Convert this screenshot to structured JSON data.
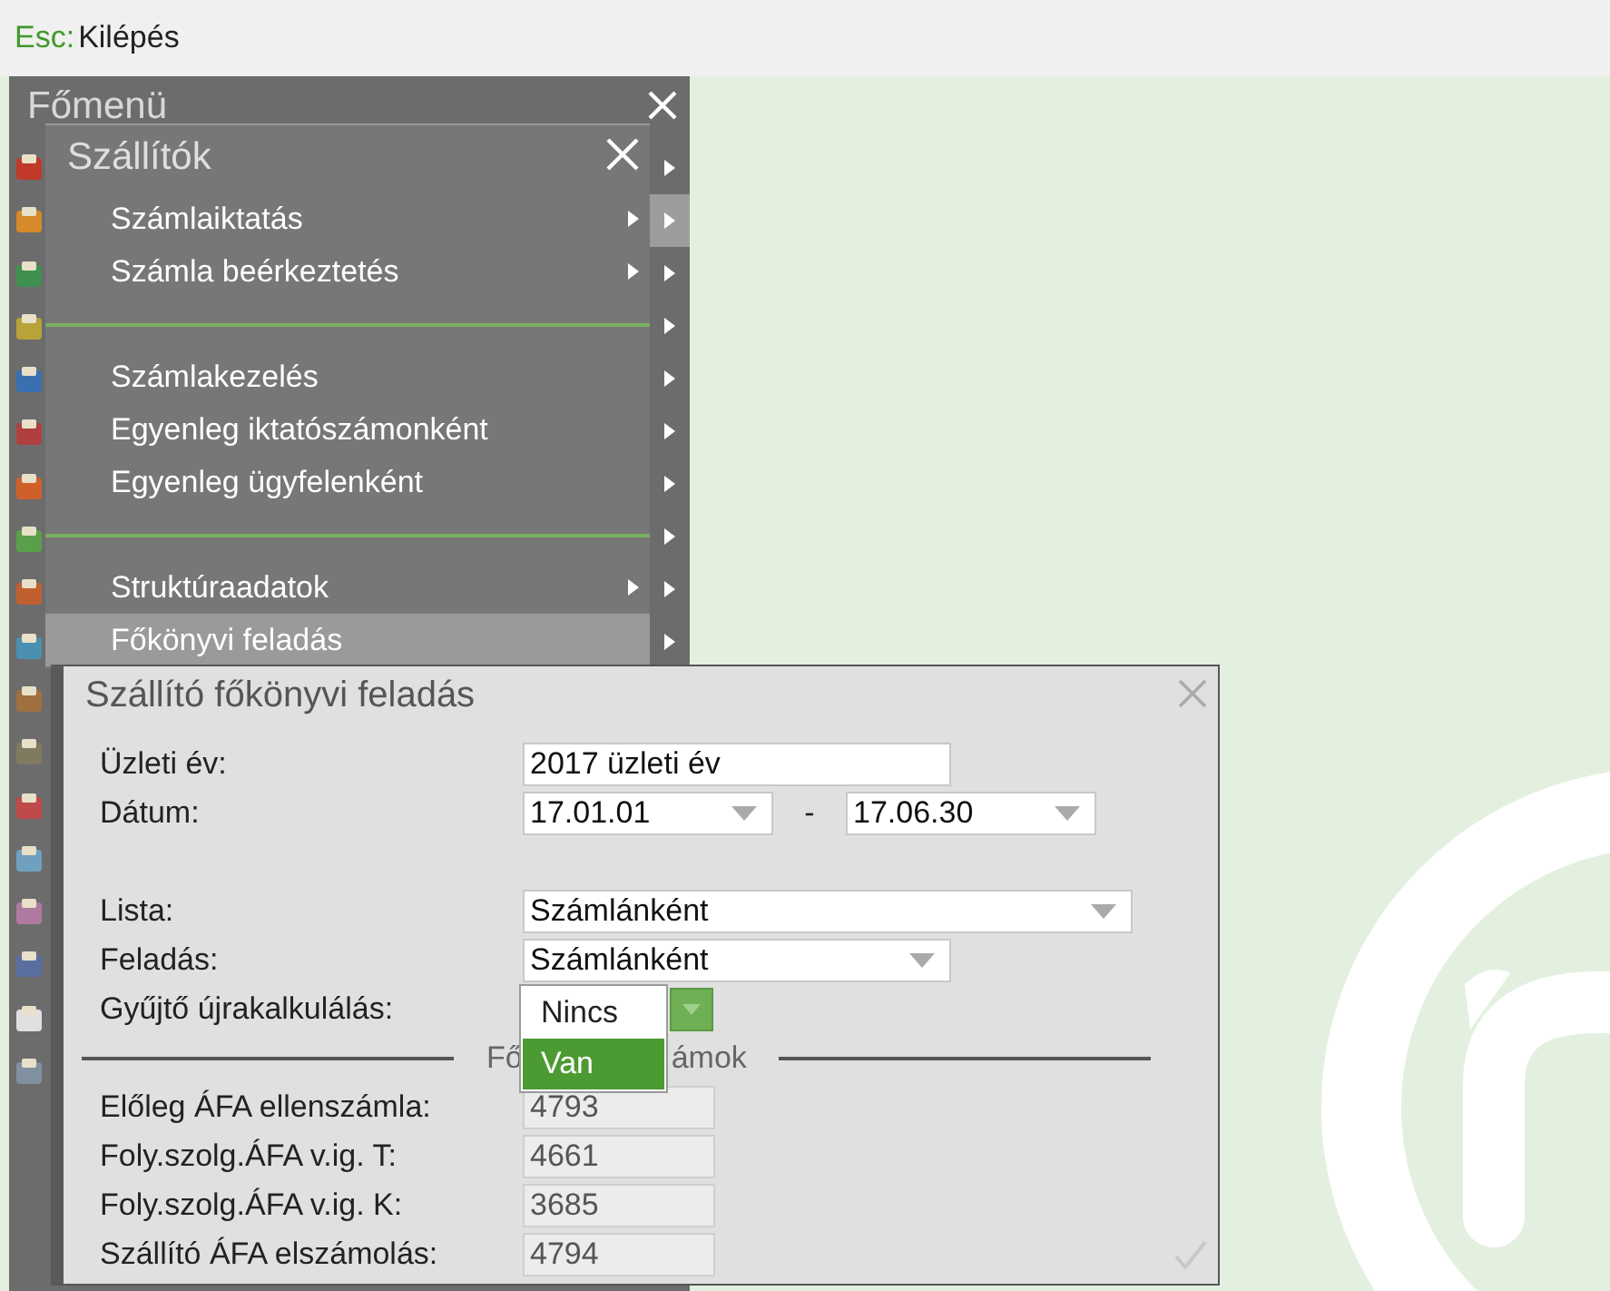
{
  "top_bar": {
    "key": "Esc:",
    "label": "Kilépés"
  },
  "main_menu": {
    "title": "Főmenü",
    "rows": [
      {
        "selected": false
      },
      {
        "selected": true
      },
      {
        "selected": false
      },
      {
        "selected": false
      },
      {
        "selected": false
      },
      {
        "selected": false
      },
      {
        "selected": false
      },
      {
        "selected": false
      },
      {
        "selected": false
      },
      {
        "selected": false
      }
    ]
  },
  "submenu": {
    "title": "Szállítók",
    "items": [
      {
        "kind": "item",
        "label": "Számlaiktatás",
        "has_submenu": true,
        "selected": false
      },
      {
        "kind": "item",
        "label": "Számla beérkeztetés",
        "has_submenu": true,
        "selected": false
      },
      {
        "kind": "separator"
      },
      {
        "kind": "item",
        "label": "Számlakezelés",
        "has_submenu": false,
        "selected": false
      },
      {
        "kind": "item",
        "label": "Egyenleg iktatószámonként",
        "has_submenu": false,
        "selected": false
      },
      {
        "kind": "item",
        "label": "Egyenleg ügyfelenként",
        "has_submenu": false,
        "selected": false
      },
      {
        "kind": "separator"
      },
      {
        "kind": "item",
        "label": "Struktúraadatok",
        "has_submenu": true,
        "selected": false
      },
      {
        "kind": "item",
        "label": "Főkönyvi feladás",
        "has_submenu": false,
        "selected": true
      }
    ]
  },
  "dialog": {
    "title": "Szállító főkönyvi feladás",
    "period": [
      {
        "kind": "text",
        "label": "Üzleti év:",
        "value": "2017 üzleti év"
      },
      {
        "kind": "date_range",
        "label": "Dátum:",
        "from": "17.01.01",
        "separator": "-",
        "to": "17.06.30"
      }
    ],
    "options": [
      {
        "kind": "select",
        "label": "Lista:",
        "value": "Számlánként"
      },
      {
        "kind": "select",
        "label": "Feladás:",
        "value": "Számlánként"
      },
      {
        "kind": "open_select",
        "label": "Gyűjtő újrakalkulálás:",
        "choices": [
          {
            "label": "Nincs",
            "selected": false
          },
          {
            "label": "Van",
            "selected": true
          }
        ]
      }
    ],
    "legend_parts": [
      "Fő",
      "ámok"
    ],
    "accounts": [
      {
        "label": "Előleg ÁFA ellenszámla:",
        "value": "4793"
      },
      {
        "label": "Foly.szolg.ÁFA v.ig. T:",
        "value": "4661"
      },
      {
        "label": "Foly.szolg.ÁFA v.ig. K:",
        "value": "3685"
      },
      {
        "label": "Szállító ÁFA elszámolás:",
        "value": "4794"
      }
    ]
  }
}
